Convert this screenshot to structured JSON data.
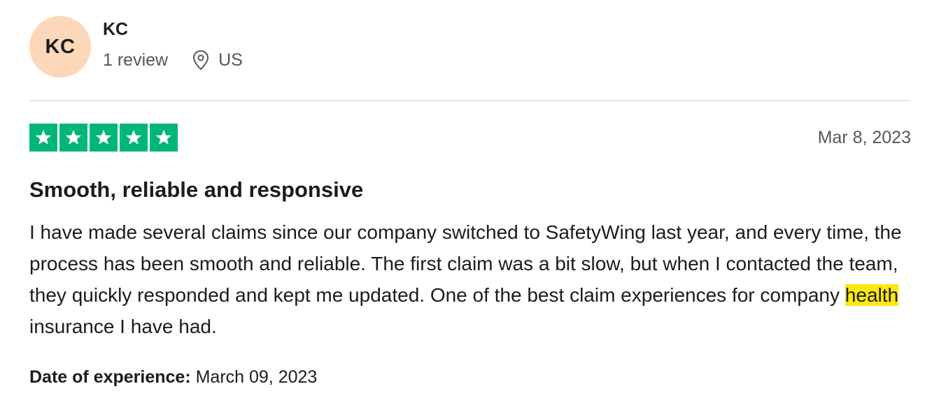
{
  "consumer": {
    "initials": "KC",
    "name": "KC",
    "review_count": "1 review",
    "location_icon": "location-pin-icon",
    "country": "US",
    "avatar_color": "#fcd7b9"
  },
  "review": {
    "rating": 5,
    "max_rating": 5,
    "star_color": "#00b67a",
    "date": "Mar 8, 2023",
    "title": "Smooth, reliable and responsive",
    "body_before": "I have made several claims since our company switched to SafetyWing last year, and every time, the process has been smooth and reliable. The first claim was a bit slow, but when I contacted the team, they quickly responded and kept me updated. One of the best claim experiences for company ",
    "body_highlight": "health",
    "body_after": " insurance I have had.",
    "highlight_color": "#fbe812",
    "experience_label": "Date of experience:",
    "experience_date": "March 09, 2023"
  }
}
